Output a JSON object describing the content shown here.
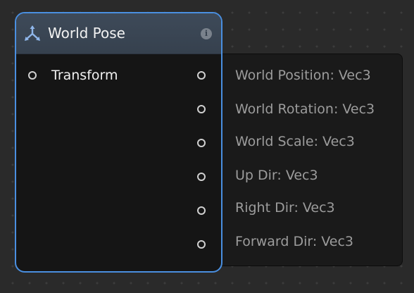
{
  "node": {
    "title": "World Pose",
    "icon": "node-tripod-icon",
    "info_icon_glyph": "i",
    "accent_color": "#4a8fe0",
    "input": {
      "label": "Transform"
    },
    "outputs": [
      {
        "label": "World Position: Vec3"
      },
      {
        "label": "World Rotation: Vec3"
      },
      {
        "label": "World Scale: Vec3"
      },
      {
        "label": "Up Dir: Vec3"
      },
      {
        "label": "Right Dir: Vec3"
      },
      {
        "label": "Forward Dir: Vec3"
      }
    ]
  }
}
